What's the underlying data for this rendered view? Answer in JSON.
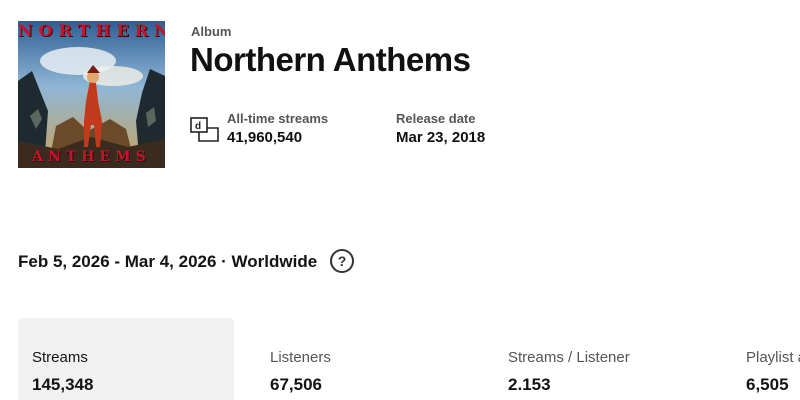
{
  "album": {
    "cover_title_top": "NORTHERN",
    "cover_title_bottom": "ANTHEMS",
    "kind_label": "Album",
    "title": "Northern Anthems"
  },
  "stats": {
    "streams_icon": "streams-icon",
    "all_time_streams_label": "All-time streams",
    "all_time_streams_value": "41,960,540",
    "release_date_label": "Release date",
    "release_date_value": "Mar 23, 2018"
  },
  "filter": {
    "range_text": "Feb 5, 2026 - Mar 4, 2026 · Worldwide",
    "help_icon": "?"
  },
  "metrics": [
    {
      "label": "Streams",
      "value": "145,348"
    },
    {
      "label": "Listeners",
      "value": "67,506"
    },
    {
      "label": "Streams / Listener",
      "value": "2.153"
    },
    {
      "label": "Playlist a",
      "value": "6,505"
    }
  ],
  "colors": {
    "accent_active_card": "#f1f1f1",
    "cover_title": "#c4162a"
  }
}
